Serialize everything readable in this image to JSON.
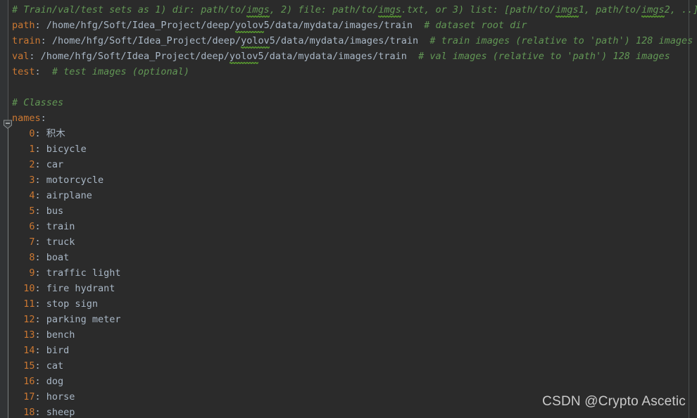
{
  "editor": {
    "background": "#2b2b2b",
    "gutter_background": "#313335",
    "colors": {
      "key": "#cc7832",
      "value": "#a9b7c6",
      "comment": "#629755",
      "squiggle": "#528b2f",
      "guide": "#4b4f50"
    },
    "fold_marker_name": "collapse-minus-icon"
  },
  "lines": {
    "l1_comment": "# Train/val/test sets as 1) dir: path/to/imgs, 2) file: path/to/imgs.txt, or 3) list: [path/to/imgs1, path/to/imgs2, ..]",
    "l1_seg_a": "# Train/val/test sets as 1) dir: path/to/",
    "l1_seg_imgs1": "imgs",
    "l1_seg_b": ", 2) file: path/to/",
    "l1_seg_imgs2": "imgs",
    "l1_seg_c": ".txt, or 3) list: [path/to/",
    "l1_seg_imgs3": "imgs",
    "l1_seg_d": "1, path/to/",
    "l1_seg_imgs4": "imgs",
    "l1_seg_e": "2, ..]",
    "path_key": "path",
    "path_colon": ":",
    "path_val_a": " /home/hfg/Soft/Idea_Project/deep/",
    "path_val_yolov": "yolov",
    "path_val_b": "5/data/mydata/images/train",
    "path_comment": "  # dataset root dir",
    "train_key": "train",
    "train_colon": ":",
    "train_val_a": " /home/hfg/Soft/Idea_Project/deep/",
    "train_val_yolov": "yolov",
    "train_val_b": "5/data/mydata/images/train",
    "train_comment": "  # train images (relative to 'path') 128 images",
    "val_key": "val",
    "val_colon": ":",
    "val_val_a": " /home/hfg/Soft/Idea_Project/deep/",
    "val_val_yolov": "yolov",
    "val_val_b": "5/data/mydata/images/train",
    "val_comment": "  # val images (relative to 'path') 128 images",
    "test_key": "test",
    "test_colon": ":",
    "test_comment": "  # test images (optional)",
    "classes_comment": "# Classes",
    "names_key": "names",
    "names_colon": ":"
  },
  "classes": [
    {
      "index": "0",
      "name": "积木",
      "cjk": true
    },
    {
      "index": "1",
      "name": "bicycle",
      "cjk": false
    },
    {
      "index": "2",
      "name": "car",
      "cjk": false
    },
    {
      "index": "3",
      "name": "motorcycle",
      "cjk": false
    },
    {
      "index": "4",
      "name": "airplane",
      "cjk": false
    },
    {
      "index": "5",
      "name": "bus",
      "cjk": false
    },
    {
      "index": "6",
      "name": "train",
      "cjk": false
    },
    {
      "index": "7",
      "name": "truck",
      "cjk": false
    },
    {
      "index": "8",
      "name": "boat",
      "cjk": false
    },
    {
      "index": "9",
      "name": "traffic light",
      "cjk": false
    },
    {
      "index": "10",
      "name": "fire hydrant",
      "cjk": false
    },
    {
      "index": "11",
      "name": "stop sign",
      "cjk": false
    },
    {
      "index": "12",
      "name": "parking meter",
      "cjk": false
    },
    {
      "index": "13",
      "name": "bench",
      "cjk": false
    },
    {
      "index": "14",
      "name": "bird",
      "cjk": false
    },
    {
      "index": "15",
      "name": "cat",
      "cjk": false
    },
    {
      "index": "16",
      "name": "dog",
      "cjk": false
    },
    {
      "index": "17",
      "name": "horse",
      "cjk": false
    },
    {
      "index": "18",
      "name": "sheep",
      "cjk": false
    }
  ],
  "watermark": {
    "text": "CSDN @Crypto Ascetic"
  }
}
